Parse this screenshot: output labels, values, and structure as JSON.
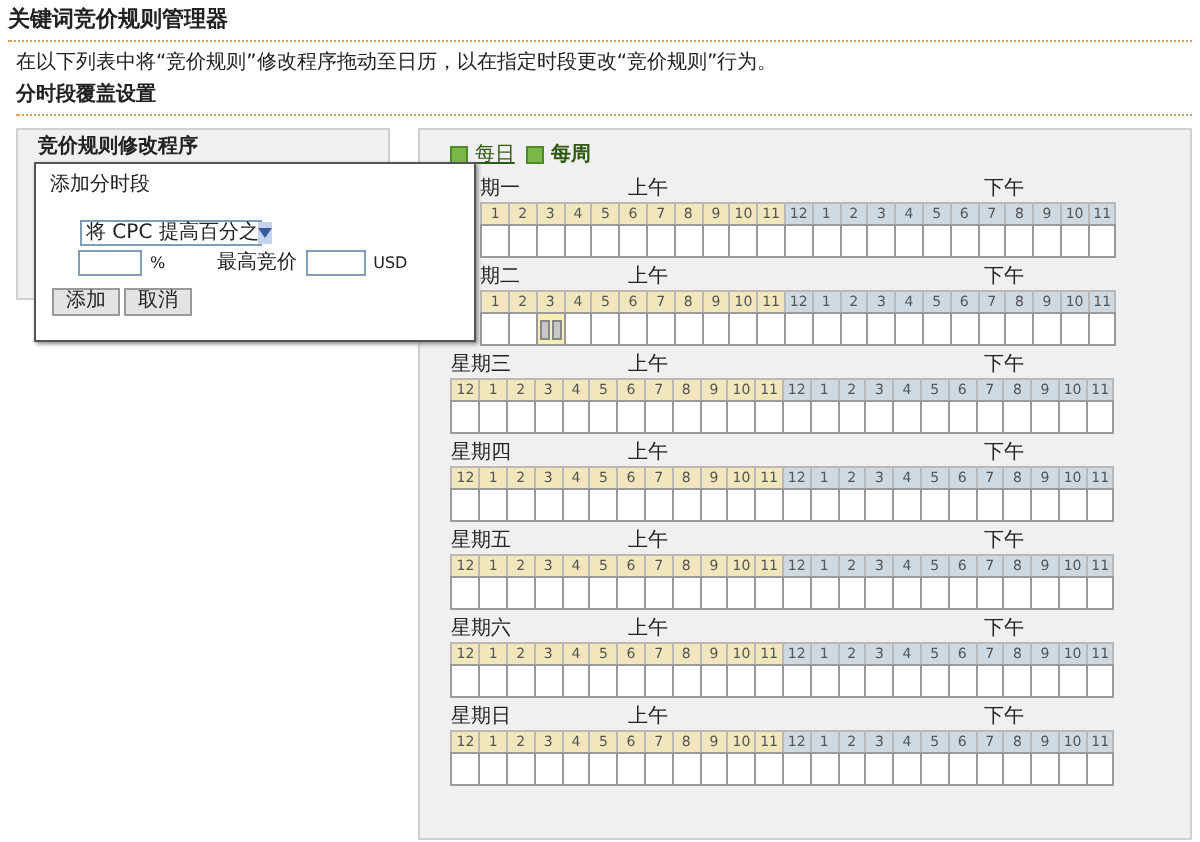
{
  "page_title": "关键词竞价规则管理器",
  "instruction": "在以下列表中将“竞价规则”修改程序拖动至日历，以在指定时段更改“竞价规则”行为。",
  "section_title": "分时段覆盖设置",
  "left_panel": {
    "title": "竞价规则修改程序"
  },
  "dialog": {
    "title": "添加分时段",
    "select_value": "将 CPC 提高百分之",
    "percent_unit": "%",
    "max_bid_label": "最高竞价",
    "currency": "USD",
    "buttons": [
      "添加",
      "取消"
    ]
  },
  "view_tabs": [
    {
      "label": "每日",
      "selected": false
    },
    {
      "label": "每周",
      "selected": true
    }
  ],
  "days": [
    {
      "name": "期一",
      "am": "上午",
      "pm": "下午",
      "hours": [
        "1",
        "2",
        "3",
        "4",
        "5",
        "6",
        "7",
        "8",
        "9",
        "10",
        "11",
        "12",
        "1",
        "2",
        "3",
        "4",
        "5",
        "6",
        "7",
        "8",
        "9",
        "10",
        "11"
      ],
      "slots": [
        false,
        false,
        false,
        false,
        false,
        false,
        false,
        false,
        false,
        false,
        false,
        false,
        false,
        false,
        false,
        false,
        false,
        false,
        false,
        false,
        false,
        false,
        false
      ]
    },
    {
      "name": "期二",
      "am": "上午",
      "pm": "下午",
      "hours": [
        "1",
        "2",
        "3",
        "4",
        "5",
        "6",
        "7",
        "8",
        "9",
        "10",
        "11",
        "12",
        "1",
        "2",
        "3",
        "4",
        "5",
        "6",
        "7",
        "8",
        "9",
        "10",
        "11"
      ],
      "slots": [
        false,
        false,
        true,
        false,
        false,
        false,
        false,
        false,
        false,
        false,
        false,
        false,
        false,
        false,
        false,
        false,
        false,
        false,
        false,
        false,
        false,
        false,
        false
      ]
    },
    {
      "name": "星期三",
      "am": "上午",
      "pm": "下午",
      "hours": [
        "12",
        "1",
        "2",
        "3",
        "4",
        "5",
        "6",
        "7",
        "8",
        "9",
        "10",
        "11",
        "12",
        "1",
        "2",
        "3",
        "4",
        "5",
        "6",
        "7",
        "8",
        "9",
        "10",
        "11"
      ],
      "slots": [
        false,
        false,
        false,
        false,
        false,
        false,
        false,
        false,
        false,
        false,
        false,
        false,
        false,
        false,
        false,
        false,
        false,
        false,
        false,
        false,
        false,
        false,
        false,
        false
      ]
    },
    {
      "name": "星期四",
      "am": "上午",
      "pm": "下午",
      "hours": [
        "12",
        "1",
        "2",
        "3",
        "4",
        "5",
        "6",
        "7",
        "8",
        "9",
        "10",
        "11",
        "12",
        "1",
        "2",
        "3",
        "4",
        "5",
        "6",
        "7",
        "8",
        "9",
        "10",
        "11"
      ],
      "slots": [
        false,
        false,
        false,
        false,
        false,
        false,
        false,
        false,
        false,
        false,
        false,
        false,
        false,
        false,
        false,
        false,
        false,
        false,
        false,
        false,
        false,
        false,
        false,
        false
      ]
    },
    {
      "name": "星期五",
      "am": "上午",
      "pm": "下午",
      "hours": [
        "12",
        "1",
        "2",
        "3",
        "4",
        "5",
        "6",
        "7",
        "8",
        "9",
        "10",
        "11",
        "12",
        "1",
        "2",
        "3",
        "4",
        "5",
        "6",
        "7",
        "8",
        "9",
        "10",
        "11"
      ],
      "slots": [
        false,
        false,
        false,
        false,
        false,
        false,
        false,
        false,
        false,
        false,
        false,
        false,
        false,
        false,
        false,
        false,
        false,
        false,
        false,
        false,
        false,
        false,
        false,
        false
      ]
    },
    {
      "name": "星期六",
      "am": "上午",
      "pm": "下午",
      "hours": [
        "12",
        "1",
        "2",
        "3",
        "4",
        "5",
        "6",
        "7",
        "8",
        "9",
        "10",
        "11",
        "12",
        "1",
        "2",
        "3",
        "4",
        "5",
        "6",
        "7",
        "8",
        "9",
        "10",
        "11"
      ],
      "slots": [
        false,
        false,
        false,
        false,
        false,
        false,
        false,
        false,
        false,
        false,
        false,
        false,
        false,
        false,
        false,
        false,
        false,
        false,
        false,
        false,
        false,
        false,
        false,
        false
      ]
    },
    {
      "name": "星期日",
      "am": "上午",
      "pm": "下午",
      "hours": [
        "12",
        "1",
        "2",
        "3",
        "4",
        "5",
        "6",
        "7",
        "8",
        "9",
        "10",
        "11",
        "12",
        "1",
        "2",
        "3",
        "4",
        "5",
        "6",
        "7",
        "8",
        "9",
        "10",
        "11"
      ],
      "slots": [
        false,
        false,
        false,
        false,
        false,
        false,
        false,
        false,
        false,
        false,
        false,
        false,
        false,
        false,
        false,
        false,
        false,
        false,
        false,
        false,
        false,
        false,
        false,
        false
      ]
    }
  ]
}
